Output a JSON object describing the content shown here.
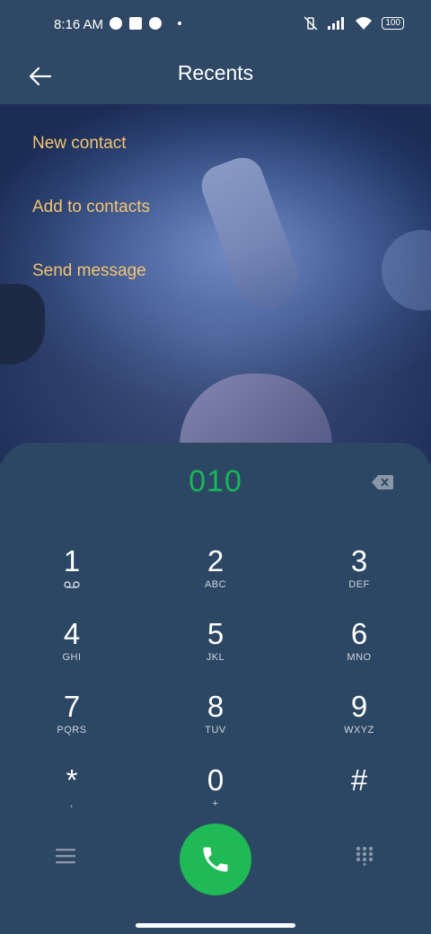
{
  "status": {
    "time": "8:16 AM",
    "battery": "100"
  },
  "appbar": {
    "title": "Recents"
  },
  "menu": {
    "new_contact": "New contact",
    "add_to_contacts": "Add to contacts",
    "send_message": "Send message"
  },
  "dialer": {
    "number": "010",
    "keys": [
      {
        "digit": "1",
        "letters": ""
      },
      {
        "digit": "2",
        "letters": "ABC"
      },
      {
        "digit": "3",
        "letters": "DEF"
      },
      {
        "digit": "4",
        "letters": "GHI"
      },
      {
        "digit": "5",
        "letters": "JKL"
      },
      {
        "digit": "6",
        "letters": "MNO"
      },
      {
        "digit": "7",
        "letters": "PQRS"
      },
      {
        "digit": "8",
        "letters": "TUV"
      },
      {
        "digit": "9",
        "letters": "WXYZ"
      },
      {
        "digit": "*",
        "letters": ","
      },
      {
        "digit": "0",
        "letters": "+"
      },
      {
        "digit": "#",
        "letters": ""
      }
    ]
  },
  "colors": {
    "accent_green": "#1fba55",
    "menu_text": "#f2c46f",
    "background": "#2c4763"
  }
}
